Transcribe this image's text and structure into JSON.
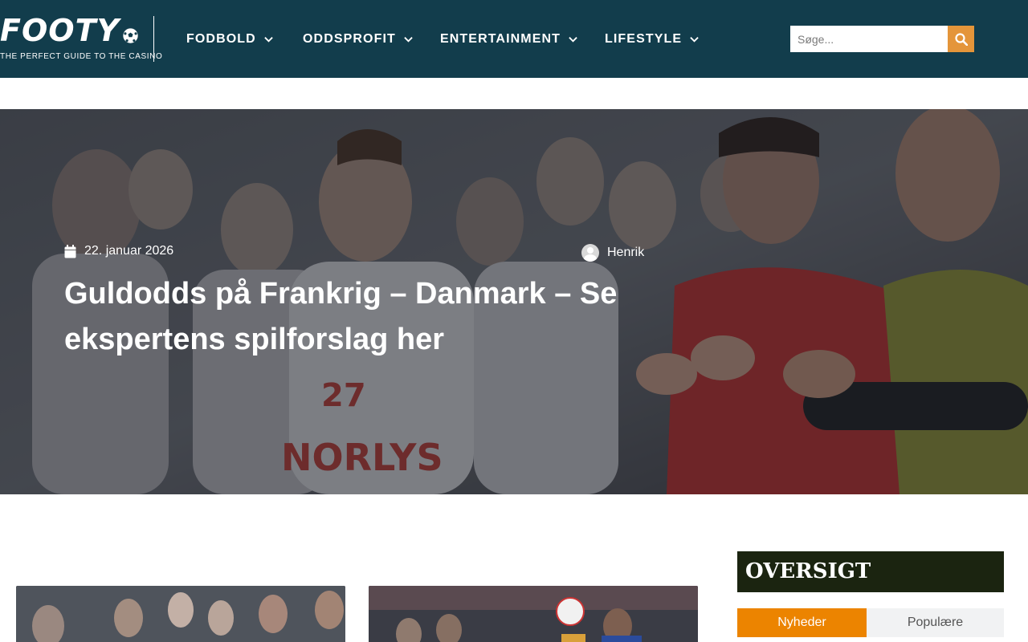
{
  "brand": {
    "name": "FOOTY",
    "tagline": "THE PERFECT GUIDE TO THE CASINO",
    "ball_icon": "soccer-ball-icon"
  },
  "nav": {
    "items": [
      {
        "label": "FODBOLD",
        "icon": "chevron-down-icon"
      },
      {
        "label": "ODDSPROFIT",
        "icon": "chevron-down-icon"
      },
      {
        "label": "ENTERTAINMENT",
        "icon": "chevron-down-icon"
      },
      {
        "label": "LIFESTYLE",
        "icon": "chevron-down-icon"
      }
    ]
  },
  "search": {
    "placeholder": "Søge...",
    "value": "",
    "button_icon": "search-icon"
  },
  "hero": {
    "date": "22. januar 2026",
    "date_icon": "calendar-icon",
    "author": "Henrik",
    "author_icon": "avatar-icon",
    "title": "Guldodds på Frankrig – Danmark – Se ekspertens spilforslag her",
    "image": "handball-players-applauding"
  },
  "sidebar": {
    "heading": "OVERSIGT",
    "tabs": [
      {
        "label": "Nyheder",
        "active": true
      },
      {
        "label": "Populære",
        "active": false
      }
    ]
  },
  "articles": [
    {
      "image": "handball-team-thumbnail"
    },
    {
      "image": "handball-match-thumbnail"
    }
  ],
  "colors": {
    "header_bg": "#123d4c",
    "accent_orange": "#e4953a",
    "tab_active": "#ec8400",
    "sidebar_heading_bg": "#1b2410"
  }
}
